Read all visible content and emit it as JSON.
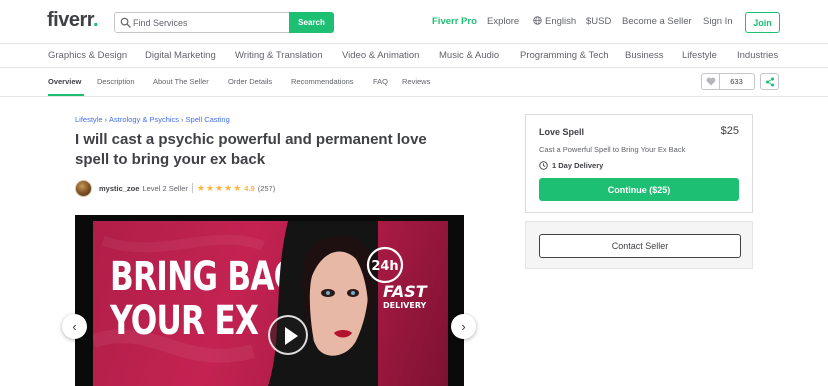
{
  "header": {
    "logo_text": "fiverr",
    "logo_dot": ".",
    "search": {
      "placeholder": "Find Services",
      "button_label": "Search"
    },
    "nav": {
      "fiverr_pro": "Fiverr Pro",
      "explore": "Explore",
      "language": "English",
      "currency": "$USD",
      "become_seller": "Become a Seller",
      "sign_in": "Sign In",
      "join": "Join"
    }
  },
  "categories": [
    "Graphics & Design",
    "Digital Marketing",
    "Writing & Translation",
    "Video & Animation",
    "Music & Audio",
    "Programming & Tech",
    "Business",
    "Lifestyle",
    "Industries"
  ],
  "subnav": {
    "tabs": [
      "Overview",
      "Description",
      "About The Seller",
      "Order Details",
      "Recommendations",
      "FAQ",
      "Reviews"
    ],
    "active_tab": "Overview",
    "favorites_count": "633"
  },
  "gig": {
    "breadcrumb": [
      "Lifestyle",
      "Astrology & Psychics",
      "Spell Casting"
    ],
    "breadcrumb_sep": "›",
    "title": "I will cast a psychic powerful and permanent love spell to bring your ex back",
    "seller": {
      "username": "mystic_zoe",
      "level": "Level 2 Seller",
      "rating": "4.9",
      "reviews": "(257)",
      "stars": 5
    },
    "media": {
      "headline_line1": "BRING BACK",
      "headline_line2": "YOUR EX",
      "badge_hours": "24h",
      "badge_fast": "FAST",
      "badge_delivery": "DELIVERY"
    }
  },
  "package": {
    "title": "Love Spell",
    "price": "$25",
    "description": "Cast a Powerful Spell to Bring Your Ex Back",
    "delivery": "1 Day Delivery",
    "continue_label": "Continue ($25)"
  },
  "contact": {
    "label": "Contact Seller"
  },
  "colors": {
    "brand_green": "#1dbf73",
    "link_blue": "#446ee7",
    "star_gold": "#ffb33e",
    "promo_red": "#c42352"
  }
}
